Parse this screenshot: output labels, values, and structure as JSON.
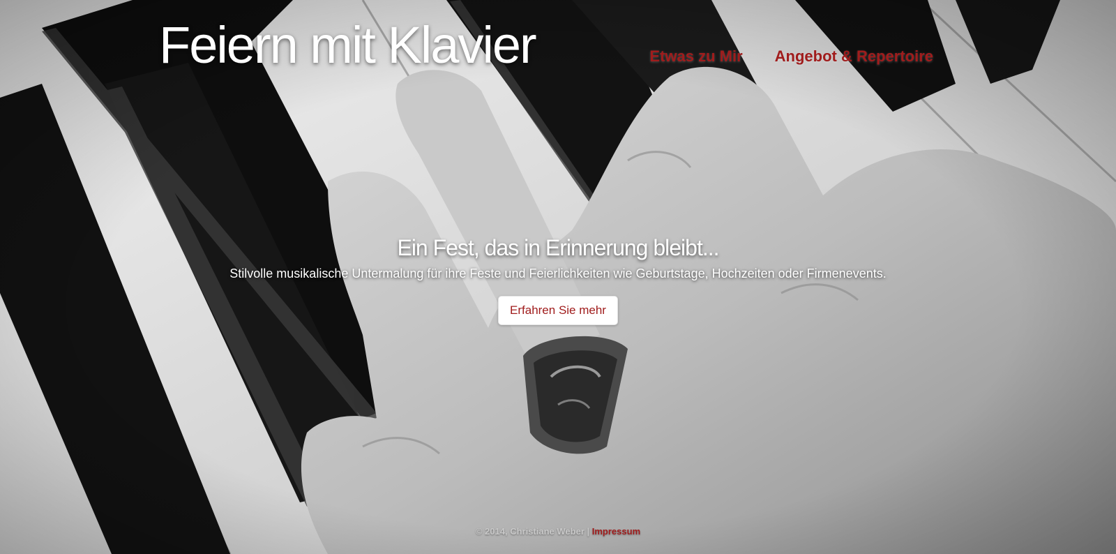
{
  "site": {
    "title": "Feiern mit Klavier"
  },
  "nav": {
    "items": [
      {
        "label": "Etwas zu Mir"
      },
      {
        "label": "Angebot & Repertoire"
      }
    ]
  },
  "hero": {
    "tagline": "Ein Fest, das in Erinnerung bleibt...",
    "subline": "Stilvolle musikalische Untermalung für ihre Feste und Feierlichkeiten wie Geburtstage, Hochzeiten oder Firmenevents.",
    "cta_label": "Erfahren Sie mehr"
  },
  "footer": {
    "copyright": "© 2014, Christiane Weber",
    "separator": "|",
    "impressum_label": "Impressum"
  },
  "colors": {
    "accent": "#a01c1c",
    "text_light": "#ffffff"
  }
}
